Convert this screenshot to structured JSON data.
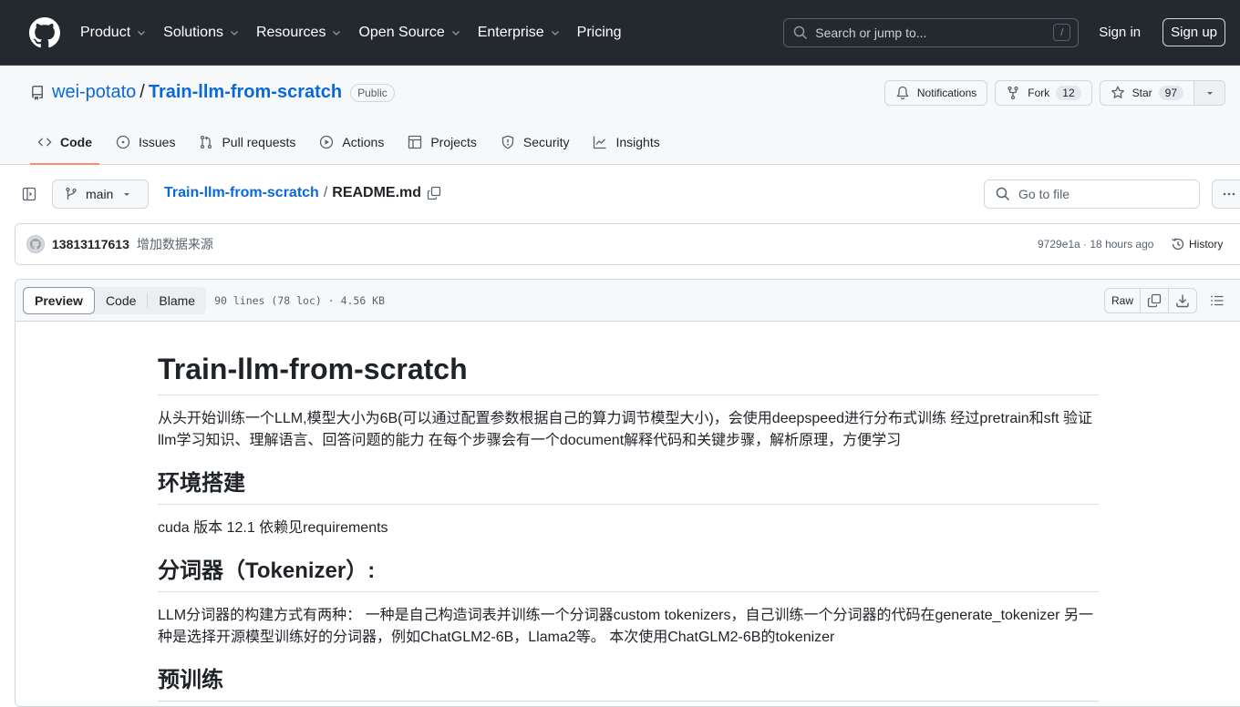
{
  "header": {
    "nav": [
      {
        "label": "Product",
        "dropdown": true
      },
      {
        "label": "Solutions",
        "dropdown": true
      },
      {
        "label": "Resources",
        "dropdown": true
      },
      {
        "label": "Open Source",
        "dropdown": true
      },
      {
        "label": "Enterprise",
        "dropdown": true
      },
      {
        "label": "Pricing",
        "dropdown": false
      }
    ],
    "search_placeholder": "Search or jump to...",
    "search_shortcut": "/",
    "sign_in": "Sign in",
    "sign_up": "Sign up"
  },
  "repo": {
    "owner": "wei-potato",
    "separator": "/",
    "name": "Train-llm-from-scratch",
    "visibility": "Public",
    "notifications_label": "Notifications",
    "fork_label": "Fork",
    "fork_count": "12",
    "star_label": "Star",
    "star_count": "97",
    "tabs": [
      {
        "label": "Code",
        "icon": "code-icon",
        "active": true
      },
      {
        "label": "Issues",
        "icon": "issue-icon",
        "active": false
      },
      {
        "label": "Pull requests",
        "icon": "pull-request-icon",
        "active": false
      },
      {
        "label": "Actions",
        "icon": "play-icon",
        "active": false
      },
      {
        "label": "Projects",
        "icon": "table-icon",
        "active": false
      },
      {
        "label": "Security",
        "icon": "shield-icon",
        "active": false
      },
      {
        "label": "Insights",
        "icon": "graph-icon",
        "active": false
      }
    ]
  },
  "file_nav": {
    "branch": "main",
    "breadcrumb_repo": "Train-llm-from-scratch",
    "breadcrumb_sep": "/",
    "breadcrumb_file": "README.md",
    "goto_placeholder": "Go to file"
  },
  "commit": {
    "author": "13813117613",
    "message": "增加数据来源",
    "meta": "9729e1a · 18 hours ago",
    "history_label": "History"
  },
  "file": {
    "tabs": [
      "Preview",
      "Code",
      "Blame"
    ],
    "active_tab": "Preview",
    "info": "90 lines (78 loc) · 4.56 KB",
    "raw_label": "Raw"
  },
  "readme": {
    "title": "Train-llm-from-scratch",
    "intro": "从头开始训练一个LLM,模型大小为6B(可以通过配置参数根据自己的算力调节模型大小)，会使用deepspeed进行分布式训练 经过pretrain和sft 验证llm学习知识、理解语言、回答问题的能力 在每个步骤会有一个document解释代码和关键步骤，解析原理，方便学习",
    "env_heading": "环境搭建",
    "env_text": "cuda 版本 12.1 依赖见requirements",
    "tokenizer_heading": "分词器（Tokenizer）:",
    "tokenizer_text": "LLM分词器的构建方式有两种： 一种是自己构造词表并训练一个分词器custom tokenizers，自己训练一个分词器的代码在generate_tokenizer 另一种是选择开源模型训练好的分词器，例如ChatGLM2-6B，Llama2等。 本次使用ChatGLM2-6B的tokenizer",
    "pretrain_heading": "预训练"
  }
}
